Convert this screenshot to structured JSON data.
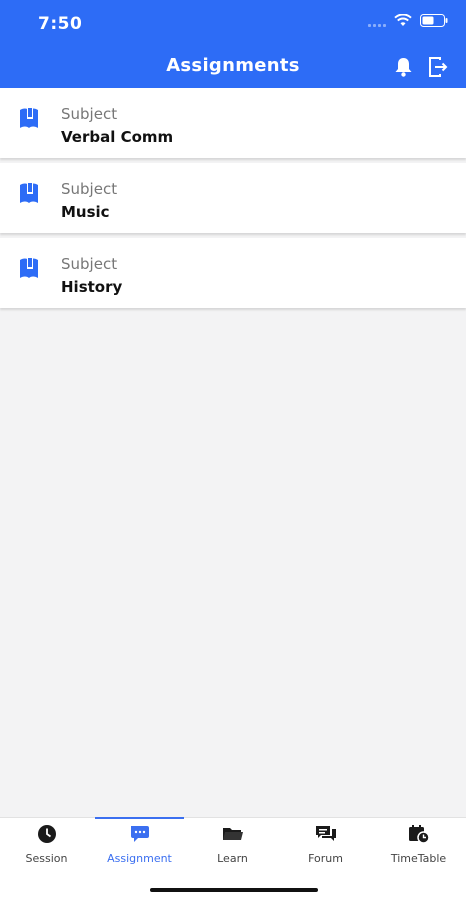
{
  "status_bar": {
    "time": "7:50"
  },
  "header": {
    "title": "Assignments",
    "icons": [
      "bell-icon",
      "logout-icon"
    ],
    "background": "#2d6cf6"
  },
  "assignments": [
    {
      "label": "Subject",
      "name": "Verbal Comm"
    },
    {
      "label": "Subject",
      "name": "Music"
    },
    {
      "label": "Subject",
      "name": "History"
    }
  ],
  "tabs": [
    {
      "label": "Session",
      "icon": "clock-icon",
      "active": false
    },
    {
      "label": "Assignment",
      "icon": "chat-icon",
      "active": true
    },
    {
      "label": "Learn",
      "icon": "folder-icon",
      "active": false
    },
    {
      "label": "Forum",
      "icon": "forum-icon",
      "active": false
    },
    {
      "label": "TimeTable",
      "icon": "calendar-clock-icon",
      "active": false
    }
  ],
  "colors": {
    "accent": "#3b6ff0",
    "background": "#f3f3f4"
  }
}
